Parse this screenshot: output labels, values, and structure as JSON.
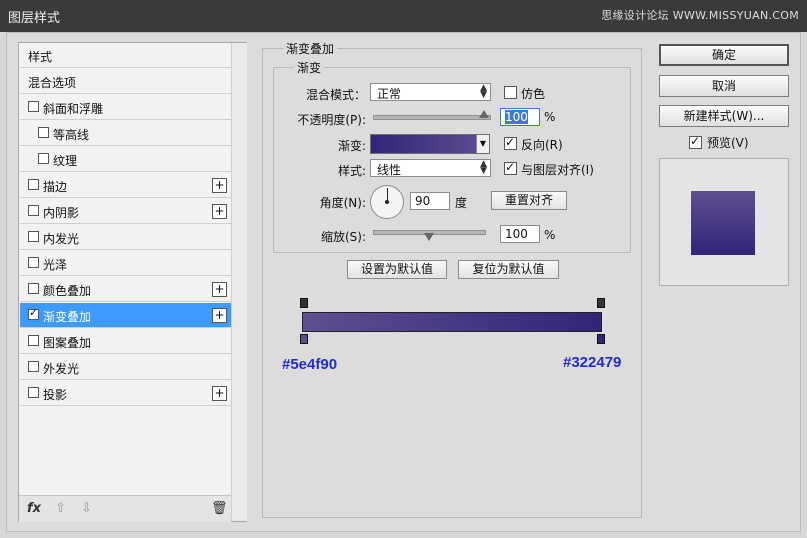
{
  "window": {
    "title": "图层样式",
    "watermark": "思缘设计论坛 WWW.MISSYUAN.COM"
  },
  "sidebar": {
    "items": [
      {
        "label": "样式",
        "has_checkbox": false,
        "checked": false,
        "has_plus": false,
        "selected": false,
        "indent": 0
      },
      {
        "label": "混合选项",
        "has_checkbox": false,
        "checked": false,
        "has_plus": false,
        "selected": false,
        "indent": 0
      },
      {
        "label": "斜面和浮雕",
        "has_checkbox": true,
        "checked": false,
        "has_plus": false,
        "selected": false,
        "indent": 0
      },
      {
        "label": "等高线",
        "has_checkbox": true,
        "checked": false,
        "has_plus": false,
        "selected": false,
        "indent": 1
      },
      {
        "label": "纹理",
        "has_checkbox": true,
        "checked": false,
        "has_plus": false,
        "selected": false,
        "indent": 1
      },
      {
        "label": "描边",
        "has_checkbox": true,
        "checked": false,
        "has_plus": true,
        "selected": false,
        "indent": 0
      },
      {
        "label": "内阴影",
        "has_checkbox": true,
        "checked": false,
        "has_plus": true,
        "selected": false,
        "indent": 0
      },
      {
        "label": "内发光",
        "has_checkbox": true,
        "checked": false,
        "has_plus": false,
        "selected": false,
        "indent": 0
      },
      {
        "label": "光泽",
        "has_checkbox": true,
        "checked": false,
        "has_plus": false,
        "selected": false,
        "indent": 0
      },
      {
        "label": "颜色叠加",
        "has_checkbox": true,
        "checked": false,
        "has_plus": true,
        "selected": false,
        "indent": 0
      },
      {
        "label": "渐变叠加",
        "has_checkbox": true,
        "checked": true,
        "has_plus": true,
        "selected": true,
        "indent": 0
      },
      {
        "label": "图案叠加",
        "has_checkbox": true,
        "checked": false,
        "has_plus": false,
        "selected": false,
        "indent": 0
      },
      {
        "label": "外发光",
        "has_checkbox": true,
        "checked": false,
        "has_plus": false,
        "selected": false,
        "indent": 0
      },
      {
        "label": "投影",
        "has_checkbox": true,
        "checked": false,
        "has_plus": true,
        "selected": false,
        "indent": 0
      }
    ],
    "bottom_icons": {
      "fx": "fx",
      "up": "⇧",
      "down": "⇩",
      "trash": "🗑"
    }
  },
  "panel": {
    "group_title": "渐变叠加",
    "subgroup_title": "渐变",
    "blend_mode_label": "混合模式：",
    "blend_mode_value": "正常",
    "dither_label": "仿色",
    "dither_checked": false,
    "opacity_label": "不透明度(P):",
    "opacity_value": "100",
    "opacity_unit": "%",
    "opacity_fraction": 1.0,
    "gradient_label": "渐变:",
    "reverse_label": "反向(R)",
    "reverse_checked": true,
    "style_label": "样式:",
    "style_value": "线性",
    "align_label": "与图层对齐(I)",
    "align_checked": true,
    "angle_label": "角度(N):",
    "angle_value": "90",
    "angle_unit": "度",
    "reset_align_label": "重置对齐",
    "scale_label": "缩放(S):",
    "scale_value": "100",
    "scale_unit": "%",
    "scale_fraction": 0.5,
    "set_default_label": "设置为默认值",
    "reset_default_label": "复位为默认值"
  },
  "gradient": {
    "start_color": "#5e4f90",
    "end_color": "#322479",
    "start_label": "#5e4f90",
    "end_label": "#322479"
  },
  "right": {
    "ok_label": "确定",
    "cancel_label": "取消",
    "new_style_label": "新建样式(W)...",
    "preview_label": "预览(V)",
    "preview_checked": true
  }
}
